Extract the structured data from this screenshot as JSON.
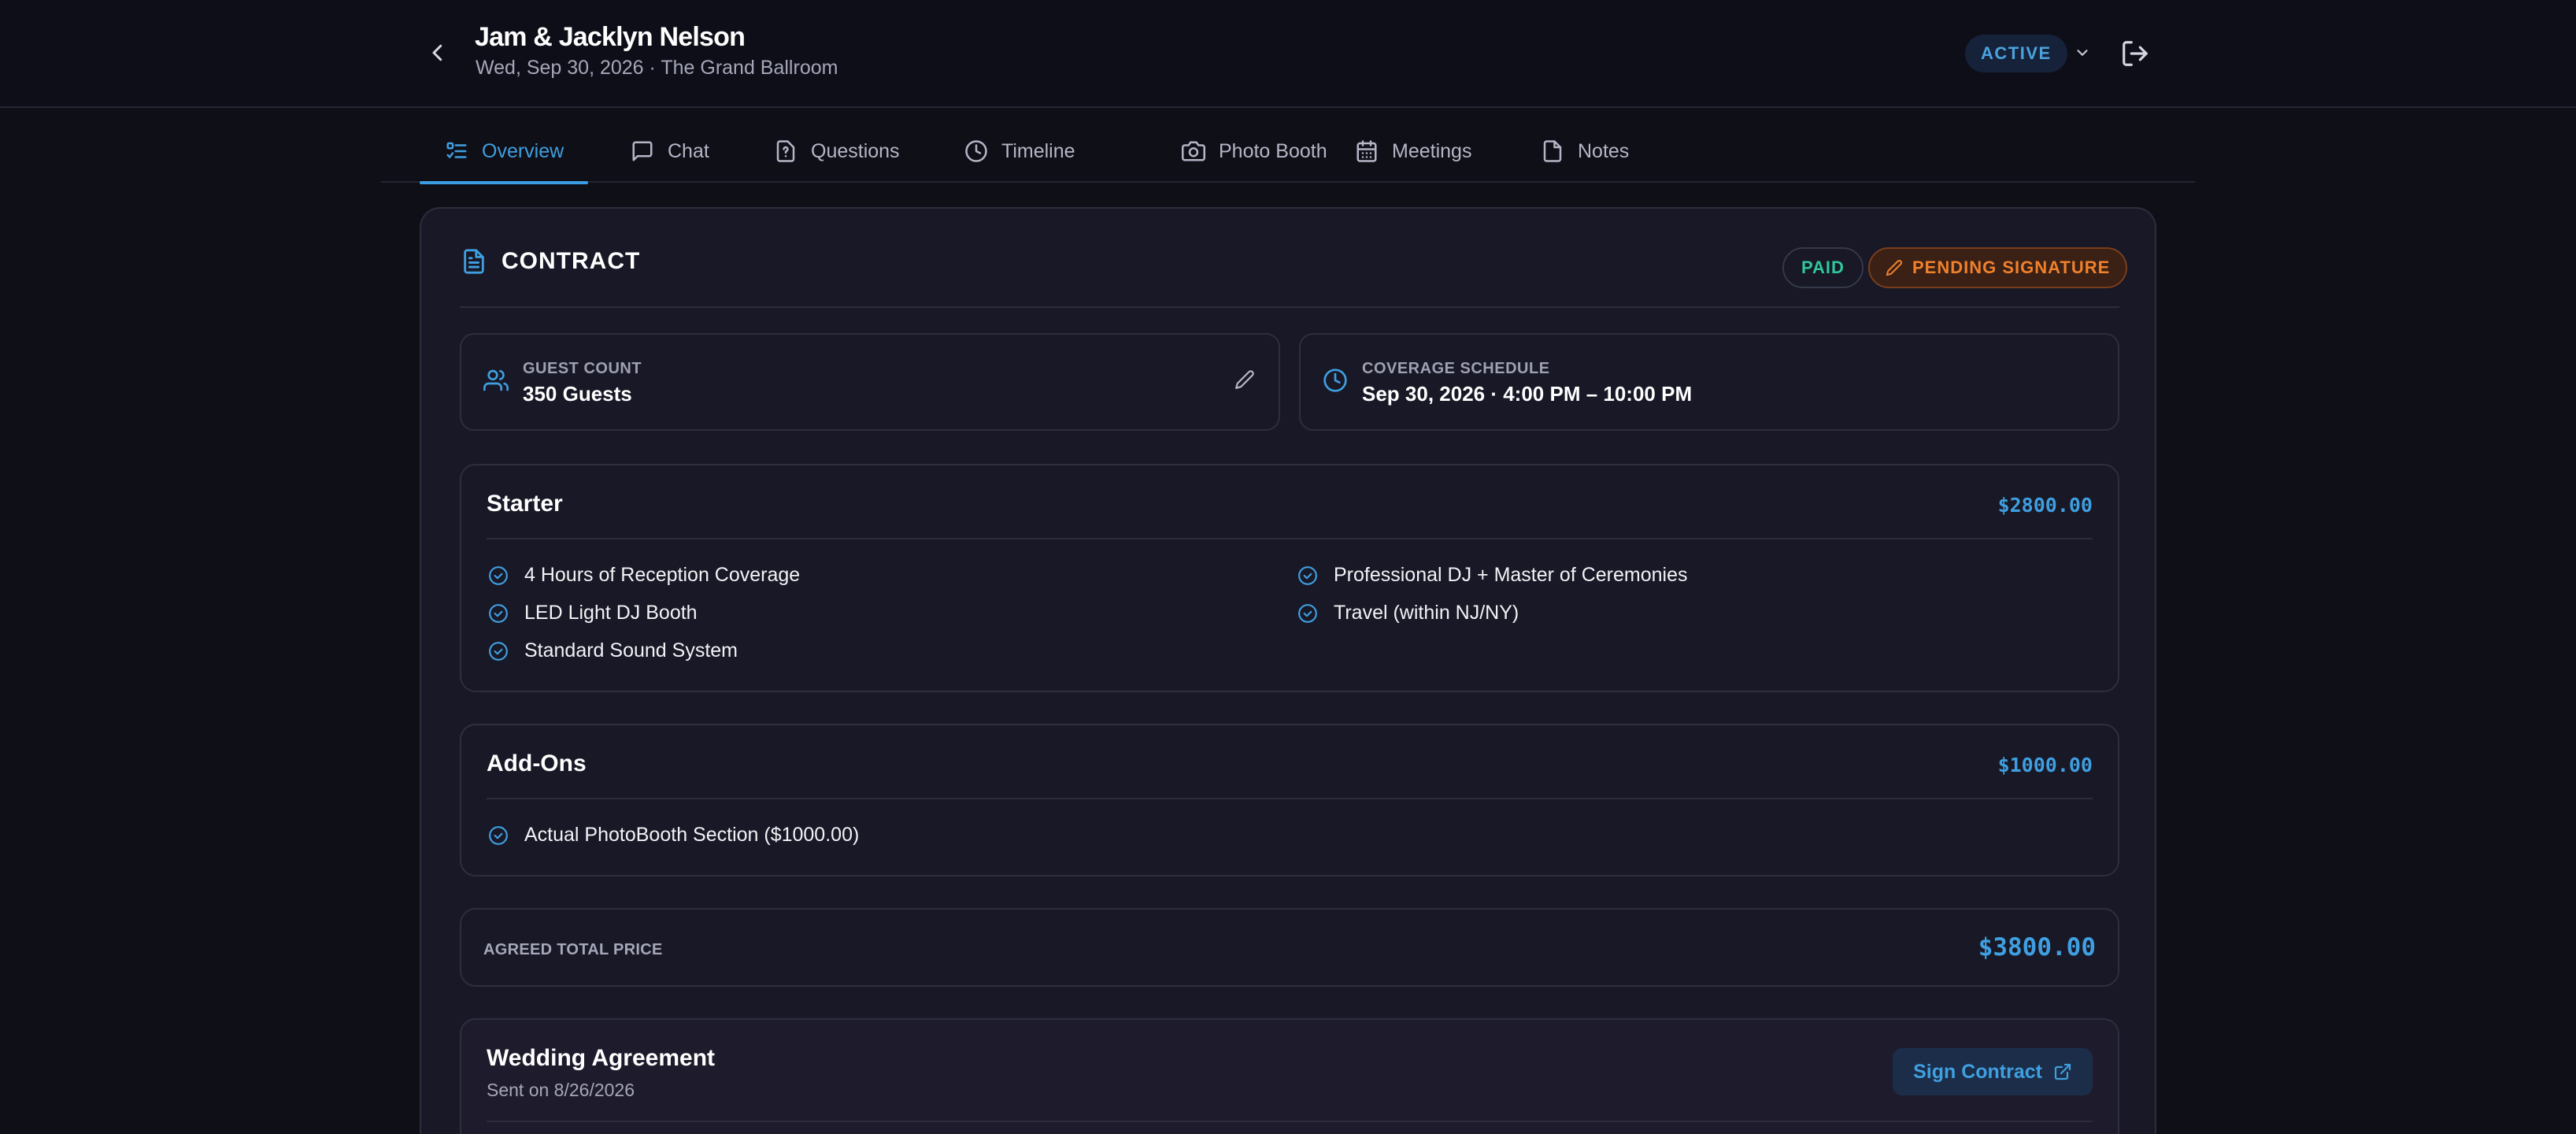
{
  "header": {
    "title": "Jam & Jacklyn Nelson",
    "subtitle": "Wed, Sep 30, 2026 · The Grand Ballroom",
    "status": "ACTIVE",
    "icons": {
      "back": "chevron-left-icon",
      "status_menu": "chevron-down-icon",
      "logout": "logout-icon"
    }
  },
  "tabs": [
    {
      "label": "Overview",
      "icon": "list-check-icon",
      "active": true
    },
    {
      "label": "Chat",
      "icon": "message-icon",
      "active": false
    },
    {
      "label": "Questions",
      "icon": "question-file-icon",
      "active": false
    },
    {
      "label": "Timeline",
      "icon": "clock-icon",
      "active": false
    },
    {
      "label": "Photo Booth",
      "icon": "camera-icon",
      "active": false
    },
    {
      "label": "Meetings",
      "icon": "calendar-icon",
      "active": false
    },
    {
      "label": "Notes",
      "icon": "note-icon",
      "active": false
    }
  ],
  "contract": {
    "title": "CONTRACT",
    "badges": {
      "paid": "PAID",
      "pending": "PENDING SIGNATURE"
    },
    "guest_count": {
      "label": "GUEST COUNT",
      "value": "350 Guests"
    },
    "coverage": {
      "label": "COVERAGE SCHEDULE",
      "value": "Sep 30, 2026 · 4:00 PM – 10:00 PM"
    },
    "package": {
      "name": "Starter",
      "price": "$2800.00",
      "features_left": [
        "4 Hours of Reception Coverage",
        "LED Light DJ Booth",
        "Standard Sound System"
      ],
      "features_right": [
        "Professional DJ + Master of Ceremonies",
        "Travel (within NJ/NY)"
      ]
    },
    "addons": {
      "name": "Add-Ons",
      "price": "$1000.00",
      "items": [
        "Actual PhotoBooth Section ($1000.00)"
      ]
    },
    "total": {
      "label": "AGREED TOTAL PRICE",
      "value": "$3800.00"
    },
    "agreement": {
      "title": "Wedding Agreement",
      "sent": "Sent on 8/26/2026",
      "sign_label": "Sign Contract"
    }
  },
  "colors": {
    "accent": "#3f9fe0",
    "paid": "#2fc79a",
    "pending": "#f0812c",
    "background": "#0f0f18",
    "panel": "#181826"
  }
}
